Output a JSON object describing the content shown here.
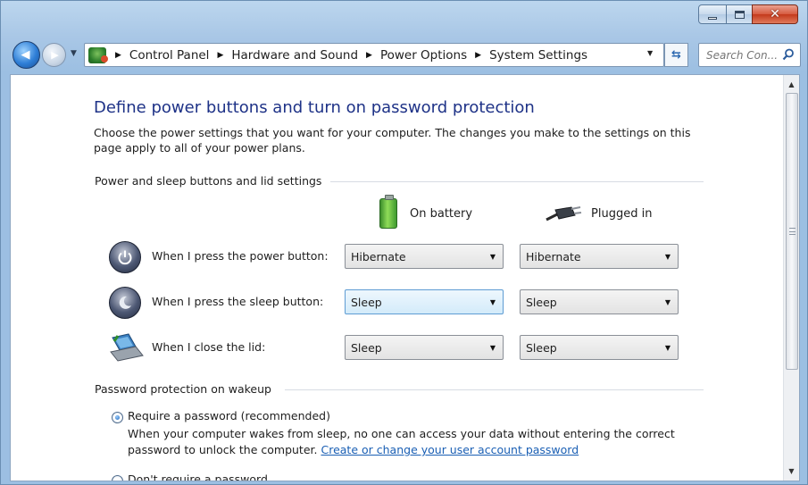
{
  "window": {
    "minimize_icon": "minimize-icon",
    "maximize_icon": "maximize-icon",
    "close_icon": "close-icon",
    "close_glyph": "✕"
  },
  "navigation": {
    "back_glyph": "◀",
    "forward_glyph": "▶",
    "breadcrumbs": [
      "Control Panel",
      "Hardware and Sound",
      "Power Options",
      "System Settings"
    ],
    "search_placeholder": "Search Con..."
  },
  "page": {
    "title": "Define power buttons and turn on password protection",
    "intro": "Choose the power settings that you want for your computer. The changes you make to the settings on this page apply to all of your power plans."
  },
  "buttons_section": {
    "heading": "Power and sleep buttons and lid settings",
    "columns": {
      "battery": "On battery",
      "plugged": "Plugged in"
    },
    "rows": [
      {
        "label": "When I press the power button:",
        "battery": "Hibernate",
        "plugged": "Hibernate",
        "icon": "power-icon"
      },
      {
        "label": "When I press the sleep button:",
        "battery": "Sleep",
        "plugged": "Sleep",
        "icon": "moon-icon"
      },
      {
        "label": "When I close the lid:",
        "battery": "Sleep",
        "plugged": "Sleep",
        "icon": "laptop-lid-icon"
      }
    ]
  },
  "password_section": {
    "heading": "Password protection on wakeup",
    "require_label": "Require a password (recommended)",
    "require_desc": "When your computer wakes from sleep, no one can access your data without entering the correct password to unlock the computer.",
    "require_link": "Create or change your user account password",
    "no_require_label": "Don't require a password",
    "selected": "require"
  },
  "colors": {
    "title_blue": "#1e3287",
    "link_blue": "#1a5fb4",
    "chrome_blue": "#a9c7e6"
  }
}
